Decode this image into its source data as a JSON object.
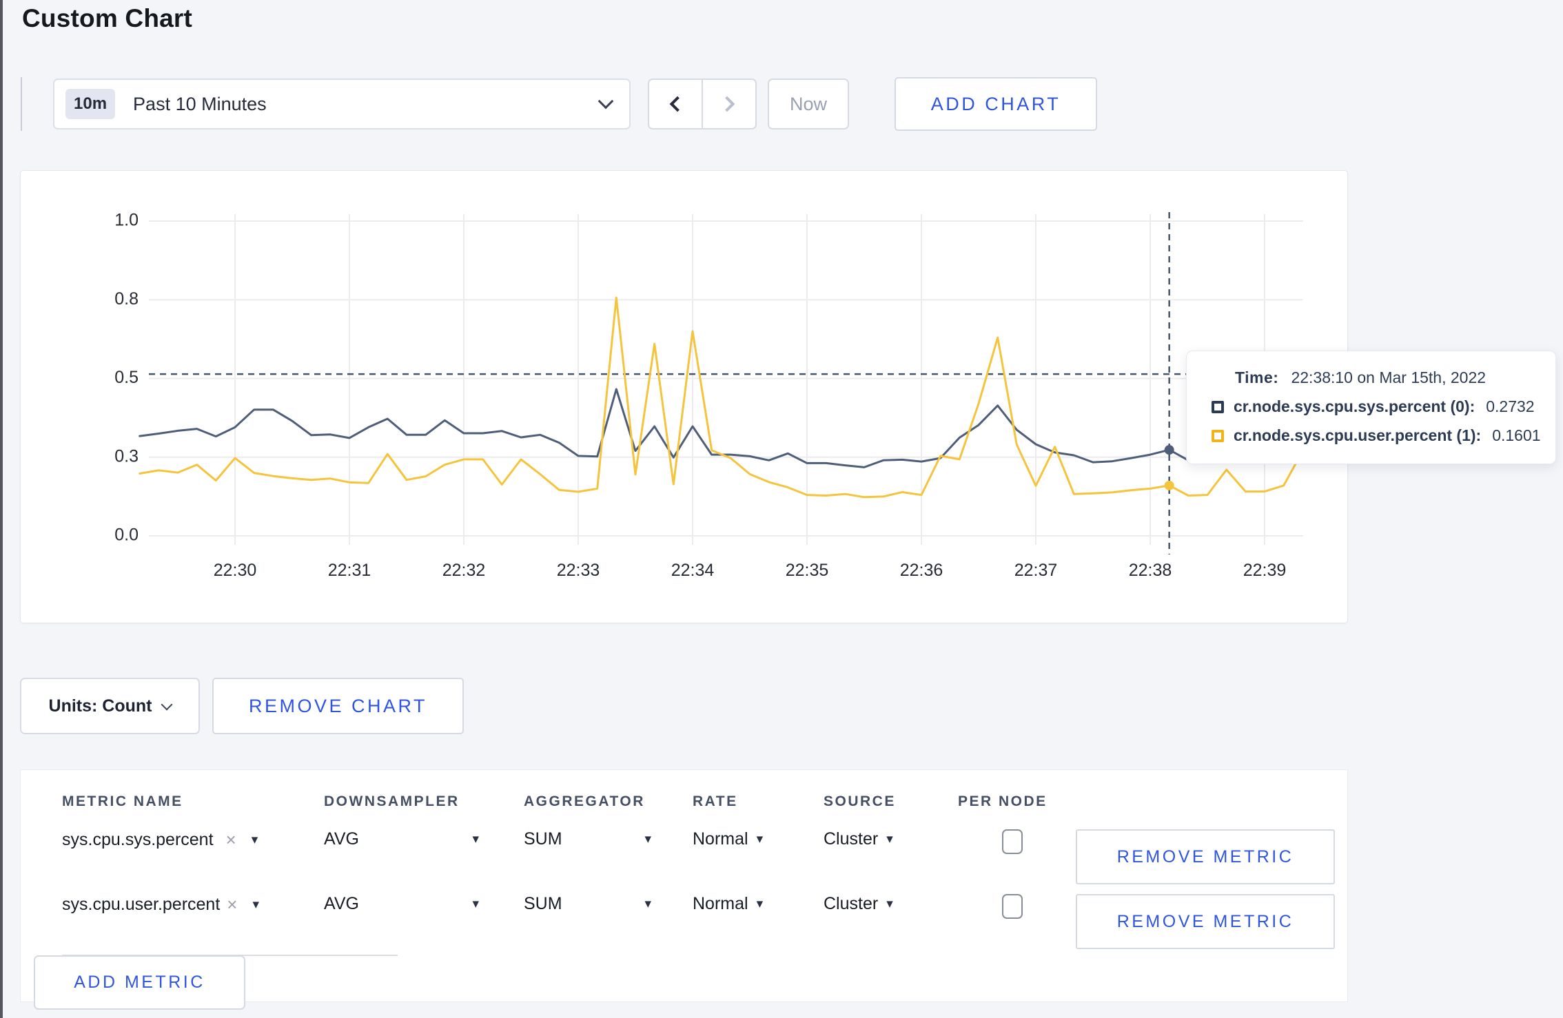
{
  "page": {
    "title": "Custom Chart"
  },
  "toolbar": {
    "range_badge": "10m",
    "range_label": "Past 10 Minutes",
    "now_label": "Now",
    "add_chart_label": "ADD CHART"
  },
  "chart_data": {
    "type": "line",
    "title": "",
    "xlabel": "",
    "ylabel": "",
    "ylim": [
      0,
      1
    ],
    "grid": true,
    "yticks": [
      {
        "pos": 0.0,
        "label": "0.0"
      },
      {
        "pos": 0.25,
        "label": "0.3"
      },
      {
        "pos": 0.5,
        "label": "0.5"
      },
      {
        "pos": 0.75,
        "label": "0.8"
      },
      {
        "pos": 1.0,
        "label": "1.0"
      }
    ],
    "xticks": [
      "22:30",
      "22:31",
      "22:32",
      "22:33",
      "22:34",
      "22:35",
      "22:36",
      "22:37",
      "22:38",
      "22:39"
    ],
    "x": [
      "22:29:10",
      "22:29:20",
      "22:29:30",
      "22:29:40",
      "22:29:50",
      "22:30:00",
      "22:30:10",
      "22:30:20",
      "22:30:30",
      "22:30:40",
      "22:30:50",
      "22:31:00",
      "22:31:10",
      "22:31:20",
      "22:31:30",
      "22:31:40",
      "22:31:50",
      "22:32:00",
      "22:32:10",
      "22:32:20",
      "22:32:30",
      "22:32:40",
      "22:32:50",
      "22:33:00",
      "22:33:10",
      "22:33:20",
      "22:33:30",
      "22:33:40",
      "22:33:50",
      "22:34:00",
      "22:34:10",
      "22:34:20",
      "22:34:30",
      "22:34:40",
      "22:34:50",
      "22:35:00",
      "22:35:10",
      "22:35:20",
      "22:35:30",
      "22:35:40",
      "22:35:50",
      "22:36:00",
      "22:36:10",
      "22:36:20",
      "22:36:30",
      "22:36:40",
      "22:36:50",
      "22:37:00",
      "22:37:10",
      "22:37:20",
      "22:37:30",
      "22:37:40",
      "22:37:50",
      "22:38:00",
      "22:38:10",
      "22:38:20",
      "22:38:30",
      "22:38:40",
      "22:38:50",
      "22:39:00",
      "22:39:10",
      "22:39:20"
    ],
    "series": [
      {
        "name": "cr.node.sys.cpu.sys.percent",
        "color": "#4e5d78",
        "values": [
          0.317,
          0.325,
          0.334,
          0.34,
          0.316,
          0.345,
          0.401,
          0.401,
          0.365,
          0.32,
          0.322,
          0.311,
          0.345,
          0.372,
          0.321,
          0.321,
          0.367,
          0.326,
          0.326,
          0.333,
          0.313,
          0.321,
          0.296,
          0.254,
          0.252,
          0.466,
          0.27,
          0.348,
          0.249,
          0.348,
          0.258,
          0.258,
          0.253,
          0.24,
          0.262,
          0.231,
          0.231,
          0.224,
          0.218,
          0.24,
          0.242,
          0.236,
          0.247,
          0.312,
          0.352,
          0.414,
          0.337,
          0.291,
          0.265,
          0.256,
          0.234,
          0.237,
          0.247,
          0.258,
          0.2732,
          0.24,
          0.255,
          0.248,
          0.262,
          0.255,
          0.262,
          0.3
        ]
      },
      {
        "name": "cr.node.sys.cpu.user.percent",
        "color": "#f5c43d",
        "values": [
          0.198,
          0.208,
          0.201,
          0.226,
          0.176,
          0.247,
          0.2,
          0.19,
          0.183,
          0.178,
          0.182,
          0.17,
          0.168,
          0.26,
          0.178,
          0.189,
          0.226,
          0.243,
          0.243,
          0.163,
          0.243,
          0.196,
          0.146,
          0.14,
          0.15,
          0.757,
          0.195,
          0.61,
          0.164,
          0.65,
          0.272,
          0.247,
          0.196,
          0.171,
          0.154,
          0.13,
          0.128,
          0.133,
          0.123,
          0.125,
          0.139,
          0.13,
          0.254,
          0.243,
          0.42,
          0.63,
          0.29,
          0.159,
          0.283,
          0.133,
          0.135,
          0.138,
          0.145,
          0.15,
          0.1601,
          0.128,
          0.13,
          0.21,
          0.141,
          0.141,
          0.16,
          0.27
        ]
      }
    ],
    "crosshair": {
      "time": "22:38:10",
      "hline_value": 0.514
    },
    "legend_position": "tooltip"
  },
  "tooltip": {
    "time_label": "Time:",
    "time_value": "22:38:10 on Mar 15th, 2022",
    "rows": [
      {
        "label": "cr.node.sys.cpu.sys.percent (0):",
        "value": "0.2732"
      },
      {
        "label": "cr.node.sys.cpu.user.percent (1):",
        "value": "0.1601"
      }
    ]
  },
  "chart_controls": {
    "units_label": "Units: Count",
    "remove_chart_label": "REMOVE CHART"
  },
  "metrics_table": {
    "headers": [
      "METRIC NAME",
      "DOWNSAMPLER",
      "AGGREGATOR",
      "RATE",
      "SOURCE",
      "PER NODE"
    ],
    "rows": [
      {
        "metric": "sys.cpu.sys.percent",
        "downsampler": "AVG",
        "aggregator": "SUM",
        "rate": "Normal",
        "source": "Cluster",
        "per_node_checked": false
      },
      {
        "metric": "sys.cpu.user.percent",
        "downsampler": "AVG",
        "aggregator": "SUM",
        "rate": "Normal",
        "source": "Cluster",
        "per_node_checked": false
      }
    ],
    "remove_metric_label": "REMOVE METRIC",
    "add_metric_label": "ADD METRIC",
    "remove_icon": "×",
    "caret_icon": "▾"
  },
  "colors": {
    "accent_blue": "#2f55e0",
    "series_sys": "#4e5d78",
    "series_user": "#f5c43d",
    "crosshair": "#44556c",
    "gridline": "#ececee"
  }
}
